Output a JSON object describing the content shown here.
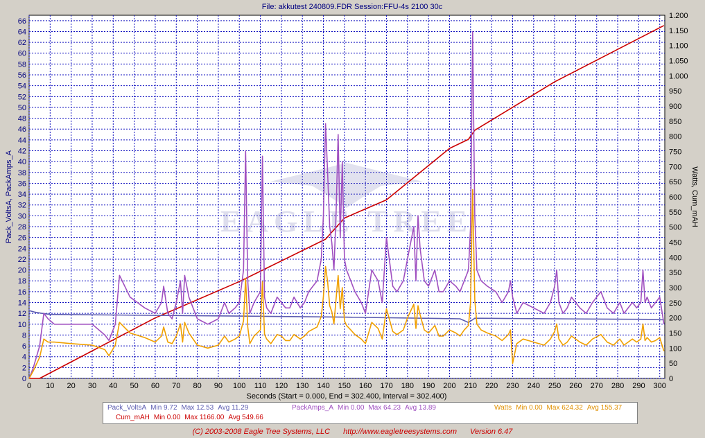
{
  "chart_data": {
    "type": "line",
    "title": "File: akkutest 240809.FDR   Session:FFU-4s 2100 30c",
    "xlabel": "Seconds (Start = 0.000,  End = 302.400,  Interval = 302.400)",
    "ylabel_left": "Pack_VoltsA, PackAmps_A",
    "ylabel_right": "Watts, Cum_mAH",
    "xlim": [
      0,
      302.4
    ],
    "ylim_left": [
      0,
      67
    ],
    "ylim_right": [
      0,
      1200
    ],
    "x_ticks": [
      "0",
      "10",
      "20",
      "30",
      "40",
      "50",
      "60",
      "70",
      "80",
      "90",
      "100",
      "110",
      "120",
      "130",
      "140",
      "150",
      "160",
      "170",
      "180",
      "190",
      "200",
      "210",
      "220",
      "230",
      "240",
      "250",
      "260",
      "270",
      "280",
      "290",
      "300"
    ],
    "y_left_ticks": [
      "0",
      "2",
      "4",
      "6",
      "8",
      "10",
      "12",
      "14",
      "16",
      "18",
      "20",
      "22",
      "24",
      "26",
      "28",
      "30",
      "32",
      "34",
      "36",
      "38",
      "40",
      "42",
      "44",
      "46",
      "48",
      "50",
      "52",
      "54",
      "56",
      "58",
      "60",
      "62",
      "64",
      "66"
    ],
    "y_right_ticks": [
      "0",
      "50",
      "100",
      "150",
      "200",
      "250",
      "300",
      "350",
      "400",
      "450",
      "500",
      "550",
      "600",
      "650",
      "700",
      "750",
      "800",
      "850",
      "900",
      "950",
      "1.000",
      "1.050",
      "1.100",
      "1.150",
      "1.200"
    ],
    "grid": true,
    "watermark": "EAGLE TREE",
    "series": [
      {
        "name": "Pack_VoltsA",
        "axis": "left",
        "color": "#5b5bb0",
        "x": [
          0,
          3,
          6,
          10,
          40,
          100,
          150,
          205,
          209,
          212,
          250,
          295,
          302
        ],
        "y": [
          12.5,
          12.2,
          12.0,
          11.8,
          11.7,
          11.5,
          11.3,
          11.0,
          10.3,
          11.1,
          11.0,
          10.9,
          10.8
        ]
      },
      {
        "name": "PackAmps_A",
        "axis": "left",
        "color": "#a050c0",
        "x": [
          0,
          2,
          5,
          7,
          9,
          12,
          20,
          30,
          36,
          38,
          41,
          43,
          48,
          55,
          60,
          63,
          64,
          66,
          68,
          70,
          72,
          73,
          74,
          76,
          80,
          85,
          90,
          93,
          95,
          98,
          100,
          102,
          103,
          104,
          105,
          107,
          110,
          111,
          112,
          113,
          115,
          118,
          120,
          122,
          124,
          126,
          129,
          131,
          133,
          137,
          139,
          140,
          141,
          142,
          143,
          144,
          145,
          146,
          147,
          148,
          149,
          150,
          151,
          153,
          155,
          158,
          160,
          163,
          166,
          168,
          170,
          172,
          173,
          175,
          178,
          180,
          183,
          184,
          185,
          186,
          188,
          190,
          193,
          195,
          197,
          200,
          203,
          205,
          207,
          209,
          210,
          211,
          212,
          213,
          215,
          218,
          222,
          225,
          228,
          229,
          230,
          232,
          235,
          240,
          245,
          248,
          250,
          251,
          252,
          254,
          256,
          258,
          260,
          262,
          265,
          268,
          272,
          275,
          278,
          281,
          283,
          285,
          287,
          289,
          291,
          292,
          293,
          294,
          296,
          298,
          300,
          302
        ],
        "y": [
          0,
          2,
          6,
          12,
          11,
          10,
          10,
          10,
          8,
          7,
          10,
          19,
          15,
          13,
          12,
          14,
          17,
          12,
          11,
          14,
          18,
          12,
          19,
          15,
          11,
          10,
          11,
          14,
          12,
          13,
          14,
          20,
          42,
          18,
          12,
          14,
          16,
          41,
          15,
          13,
          12,
          15,
          14,
          13,
          13,
          15,
          13,
          14,
          16,
          18,
          22,
          30,
          47,
          38,
          28,
          25,
          20,
          30,
          45,
          26,
          40,
          22,
          20,
          18,
          16,
          14,
          12,
          20,
          18,
          14,
          26,
          20,
          17,
          16,
          18,
          22,
          28,
          18,
          30,
          24,
          18,
          17,
          20,
          16,
          16,
          18,
          17,
          16,
          18,
          20,
          28,
          64,
          30,
          20,
          18,
          17,
          16,
          14,
          16,
          18,
          15,
          12,
          14,
          13,
          12,
          14,
          17,
          20,
          14,
          12,
          13,
          15,
          14,
          13,
          12,
          14,
          16,
          13,
          12,
          14,
          12,
          13,
          14,
          13,
          14,
          20,
          14,
          15,
          13,
          14,
          15,
          10
        ]
      },
      {
        "name": "Cum_mAH",
        "axis": "right",
        "color": "#cc0000",
        "x": [
          0,
          5,
          60,
          100,
          141,
          150,
          170,
          200,
          209,
          212,
          250,
          302
        ],
        "y": [
          0,
          0,
          200,
          320,
          460,
          530,
          590,
          760,
          790,
          820,
          980,
          1166
        ]
      },
      {
        "name": "Watts",
        "axis": "right",
        "color": "#f0a000",
        "x": [
          0,
          2,
          5,
          7,
          9,
          12,
          20,
          30,
          36,
          38,
          41,
          43,
          48,
          55,
          60,
          63,
          64,
          66,
          68,
          70,
          72,
          73,
          74,
          76,
          80,
          85,
          90,
          93,
          95,
          98,
          100,
          102,
          103,
          104,
          105,
          107,
          110,
          111,
          112,
          113,
          115,
          118,
          120,
          122,
          124,
          126,
          129,
          131,
          133,
          137,
          139,
          140,
          141,
          142,
          143,
          144,
          145,
          146,
          147,
          148,
          149,
          150,
          151,
          153,
          155,
          158,
          160,
          163,
          166,
          168,
          170,
          172,
          173,
          175,
          178,
          180,
          183,
          184,
          185,
          186,
          188,
          190,
          193,
          195,
          197,
          200,
          203,
          205,
          207,
          209,
          210,
          211,
          212,
          213,
          215,
          218,
          222,
          225,
          228,
          229,
          230,
          232,
          235,
          240,
          245,
          248,
          250,
          251,
          252,
          254,
          256,
          258,
          260,
          262,
          265,
          268,
          272,
          275,
          278,
          281,
          283,
          285,
          287,
          289,
          291,
          292,
          293,
          294,
          296,
          298,
          300,
          302
        ],
        "y": [
          0,
          25,
          70,
          130,
          120,
          120,
          115,
          110,
          95,
          75,
          110,
          185,
          150,
          135,
          120,
          140,
          170,
          120,
          115,
          140,
          180,
          120,
          185,
          150,
          110,
          100,
          110,
          140,
          120,
          130,
          140,
          190,
          330,
          170,
          115,
          140,
          160,
          320,
          145,
          130,
          115,
          145,
          140,
          125,
          125,
          145,
          130,
          140,
          155,
          170,
          205,
          270,
          370,
          320,
          240,
          220,
          180,
          260,
          340,
          230,
          300,
          190,
          175,
          160,
          145,
          130,
          115,
          185,
          165,
          130,
          230,
          180,
          155,
          145,
          160,
          200,
          245,
          165,
          240,
          210,
          160,
          150,
          175,
          140,
          140,
          160,
          150,
          140,
          160,
          175,
          250,
          624,
          260,
          180,
          160,
          150,
          140,
          125,
          145,
          160,
          50,
          115,
          130,
          120,
          110,
          130,
          155,
          180,
          130,
          110,
          120,
          140,
          130,
          120,
          110,
          130,
          145,
          120,
          110,
          130,
          110,
          120,
          130,
          120,
          130,
          180,
          125,
          135,
          120,
          125,
          135,
          90
        ]
      }
    ]
  },
  "stats": {
    "volts": {
      "name": "Pack_VoltsA",
      "min": "Min 9.72",
      "max": "Max 12.53",
      "avg": "Avg 11.29"
    },
    "amps": {
      "name": "PackAmps_A",
      "min": "Min 0.00",
      "max": "Max 64.23",
      "avg": "Avg 13.89"
    },
    "watts": {
      "name": "Watts",
      "min": "Min 0.00",
      "max": "Max 624.32",
      "avg": "Avg 155.37"
    },
    "cum": {
      "name": "Cum_mAH",
      "min": "Min 0.00",
      "max": "Max 1166.00",
      "avg": "Avg 549.66"
    }
  },
  "footer": {
    "copyright": "(C) 2003-2008 Eagle Tree Systems, LLC",
    "url": "http://www.eagletreesystems.com",
    "version": "Version 6.47"
  }
}
